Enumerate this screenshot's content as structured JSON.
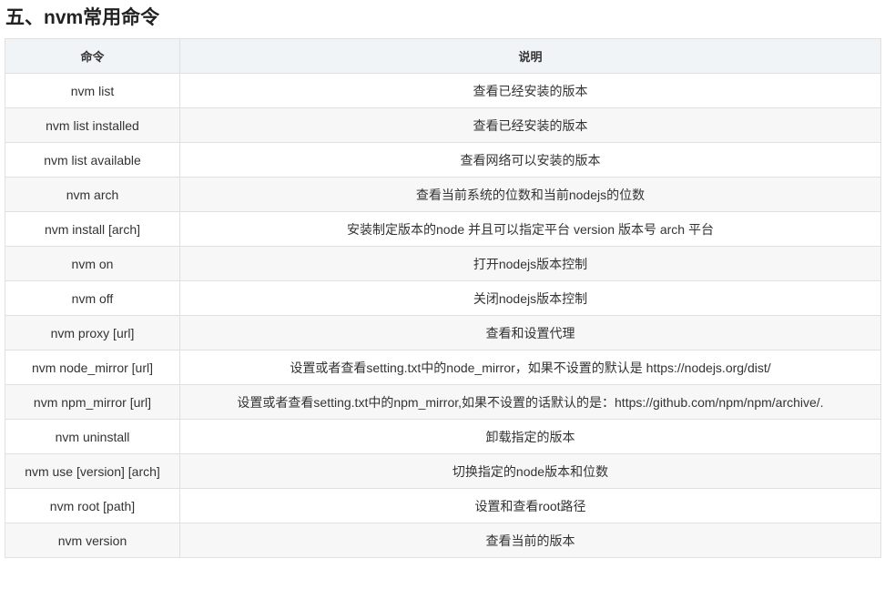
{
  "heading": "五、nvm常用命令",
  "table": {
    "headers": [
      "命令",
      "说明"
    ],
    "rows": [
      {
        "command": "nvm list",
        "description": "查看已经安装的版本"
      },
      {
        "command": "nvm list installed",
        "description": "查看已经安装的版本"
      },
      {
        "command": "nvm list available",
        "description": "查看网络可以安装的版本"
      },
      {
        "command": "nvm arch",
        "description": "查看当前系统的位数和当前nodejs的位数"
      },
      {
        "command": "nvm install [arch]",
        "description": "安装制定版本的node 并且可以指定平台 version 版本号 arch 平台"
      },
      {
        "command": "nvm on",
        "description": "打开nodejs版本控制"
      },
      {
        "command": "nvm off",
        "description": "关闭nodejs版本控制"
      },
      {
        "command": "nvm proxy [url]",
        "description": "查看和设置代理"
      },
      {
        "command": "nvm node_mirror [url]",
        "description": "设置或者查看setting.txt中的node_mirror，如果不设置的默认是 https://nodejs.org/dist/"
      },
      {
        "command": "nvm npm_mirror [url]",
        "description": "设置或者查看setting.txt中的npm_mirror,如果不设置的话默认的是：https://github.com/npm/npm/archive/."
      },
      {
        "command": "nvm uninstall",
        "description": "卸载指定的版本"
      },
      {
        "command": "nvm use [version] [arch]",
        "description": "切换指定的node版本和位数"
      },
      {
        "command": "nvm root [path]",
        "description": "设置和查看root路径"
      },
      {
        "command": "nvm version",
        "description": "查看当前的版本"
      }
    ]
  }
}
